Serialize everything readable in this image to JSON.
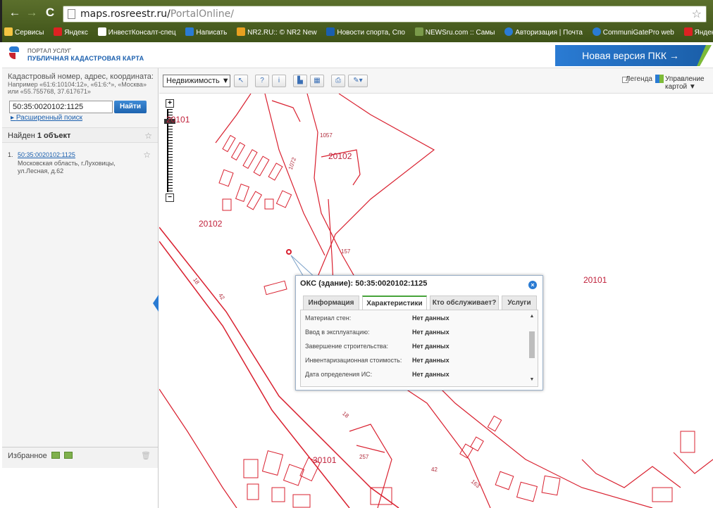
{
  "browser": {
    "url_host": "maps.rosreestr.ru/",
    "url_path": "PortalOnline/",
    "bookmarks": [
      {
        "label": "Сервисы",
        "color": "#f4c542"
      },
      {
        "label": "Яндекс",
        "color": "#d22"
      },
      {
        "label": "ИнвестКонсалт-спец",
        "color": "#333"
      },
      {
        "label": "Написать",
        "color": "#2a7bd3"
      },
      {
        "label": "NR2.RU:: © NR2 New",
        "color": "#e8a020"
      },
      {
        "label": "Новости спорта, Спо",
        "color": "#1a5fae"
      },
      {
        "label": "NEWSru.com :: Самы",
        "color": "#7a9a4a"
      },
      {
        "label": "Авторизация | Почта",
        "color": "#2a7bd3"
      },
      {
        "label": "CommuniGatePro web",
        "color": "#2a7bd3"
      },
      {
        "label": "Яндекс",
        "color": "#d22"
      }
    ]
  },
  "header": {
    "logo_line1": "ПОРТАЛ УСЛУГ",
    "logo_line2": "ПУБЛИЧНАЯ КАДАСТРОВАЯ КАРТА",
    "new_version": "Новая версия ПКК →"
  },
  "search": {
    "hint": "Кадастровый номер, адрес, координата:",
    "example": "Например «61:6:10104:12», «61:6:*», «Москва» или «55.755768, 37.617671»",
    "value": "50:35:0020102:1125",
    "find_label": "Найти",
    "advanced_label": "Расширенный поиск"
  },
  "results": {
    "found_prefix": "Найден ",
    "found_count": "1 объект",
    "items": [
      {
        "num": "1.",
        "cadastral": "50:35:0020102:1125",
        "address": "Московская область, г.Луховицы, ул.Лесная, д.62"
      }
    ]
  },
  "favorites": {
    "label": "Избранное"
  },
  "toolbar": {
    "layer": "Недвижимость ▼",
    "legend": "Легенда",
    "map_control": "Управление картой ▼"
  },
  "map": {
    "labels": [
      {
        "text": "20101"
      },
      {
        "text": "20102"
      },
      {
        "text": "20102"
      },
      {
        "text": "20101"
      },
      {
        "text": "30101"
      },
      {
        "text": "1057"
      },
      {
        "text": "1072"
      },
      {
        "text": "157"
      },
      {
        "text": "18"
      },
      {
        "text": "42"
      },
      {
        "text": "18"
      },
      {
        "text": "257"
      },
      {
        "text": "42"
      },
      {
        "text": "163"
      }
    ]
  },
  "popup": {
    "title": "ОКС (здание): 50:35:0020102:1125",
    "tabs": [
      "Информация",
      "Характеристики",
      "Кто обслуживает?",
      "Услуги"
    ],
    "active_tab": "Характеристики",
    "rows": [
      {
        "key": "Материал стен:",
        "value": "Нет данных"
      },
      {
        "key": "Ввод в эксплуатацию:",
        "value": "Нет данных"
      },
      {
        "key": "Завершение строительства:",
        "value": "Нет данных"
      },
      {
        "key": "Инвентаризационная стоимость:",
        "value": "Нет данных"
      },
      {
        "key": "Дата определения ИС:",
        "value": "Нет данных"
      }
    ]
  },
  "colors": {
    "parcel_line": "#d9202f",
    "accent": "#2a7bd3"
  }
}
